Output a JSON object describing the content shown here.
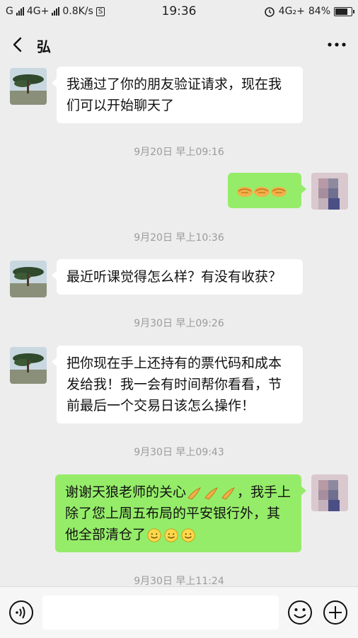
{
  "status_bar": {
    "carrier1": "G",
    "carrier2": "4G+",
    "speed": "0.8K/s",
    "s_badge": "S",
    "time": "19:36",
    "network_right": "4G₂+",
    "battery": "84%"
  },
  "header": {
    "title": "弘",
    "back_icon": "chevron-left-icon",
    "more_icon": "ellipsis-icon"
  },
  "messages": [
    {
      "from": "them",
      "text": "我通过了你的朋友验证请求，现在我们可以开始聊天了"
    },
    {
      "timestamp": "9月20日 早上09:16"
    },
    {
      "from": "me",
      "emojis": [
        "handshake",
        "handshake",
        "handshake"
      ]
    },
    {
      "timestamp": "9月20日 早上10:36"
    },
    {
      "from": "them",
      "text": "最近听课觉得怎么样？有没有收获？"
    },
    {
      "timestamp": "9月30日 早上09:26"
    },
    {
      "from": "them",
      "text": "把你现在手上还持有的票代码和成本发给我！我一会有时间帮你看看，节前最后一个交易日该怎么操作！"
    },
    {
      "timestamp": "9月30日 早上09:43"
    },
    {
      "from": "me",
      "text_a": "谢谢天狼老师的关心",
      "text_b": "，我手上除了您上周五布局的平安银行外，其他全部清仓了",
      "emojis": [
        "clap",
        "clap",
        "clap",
        "smile",
        "smile",
        "smile"
      ]
    },
    {
      "timestamp": "9月30日 早上11:24"
    }
  ],
  "input_bar": {
    "voice_icon": "voice-icon",
    "emoji_icon": "emoji-icon",
    "plus_icon": "plus-icon",
    "value": ""
  },
  "colors": {
    "background": "#ededed",
    "bubble_in": "#ffffff",
    "bubble_out": "#95ec69",
    "timestamp": "#9b9b9b"
  }
}
